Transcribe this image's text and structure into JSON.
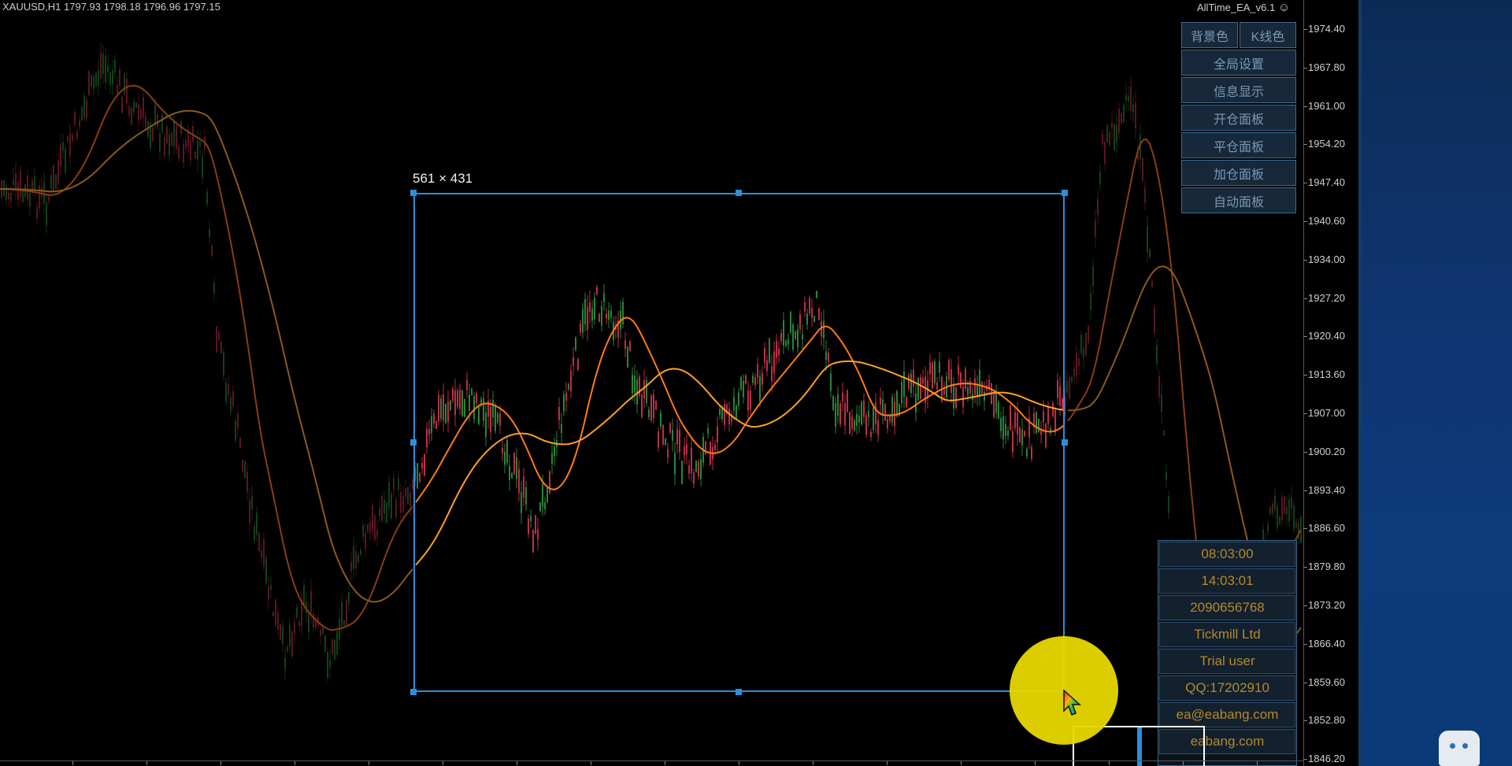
{
  "header": {
    "symbol_info": "XAUUSD,H1  1797.93 1798.18 1796.96 1797.15",
    "ea_title": "AllTime_EA_v6.1",
    "ea_title_icon": "smiley-icon"
  },
  "panel": {
    "bg_color_button": "背景色",
    "kline_color_button": "K线色",
    "buttons": [
      "全局设置",
      "信息显示",
      "开仓面板",
      "平仓面板",
      "加仓面板",
      "自动面板"
    ]
  },
  "info_box": {
    "rows": [
      "08:03:00",
      "14:03:01",
      "2090656768",
      "Tickmill Ltd",
      "Trial user",
      "QQ:17202910",
      "ea@eabang.com",
      "eabang.com"
    ]
  },
  "selection": {
    "label": "561 × 431"
  },
  "price_axis": {
    "ticks": [
      "1974.40",
      "1967.80",
      "1961.00",
      "1954.20",
      "1947.40",
      "1940.60",
      "1934.00",
      "1927.20",
      "1920.40",
      "1913.60",
      "1907.00",
      "1900.20",
      "1893.40",
      "1886.60",
      "1879.80",
      "1873.20",
      "1866.40",
      "1859.60",
      "1852.80",
      "1846.20"
    ]
  },
  "colors": {
    "selection": "#2b8fdc",
    "panel_text": "#7c98b2",
    "info_text": "#b38a2a",
    "ma_fast": "#ff7a1a",
    "ma_slow": "#ff9f2a",
    "ma_fast_dim": "#8a3c12",
    "ma_slow_dim": "#8a5a1a",
    "candle_bull": "#2a8a3a",
    "candle_bear": "#c2304a",
    "cursor_highlight": "#e8d800"
  }
}
